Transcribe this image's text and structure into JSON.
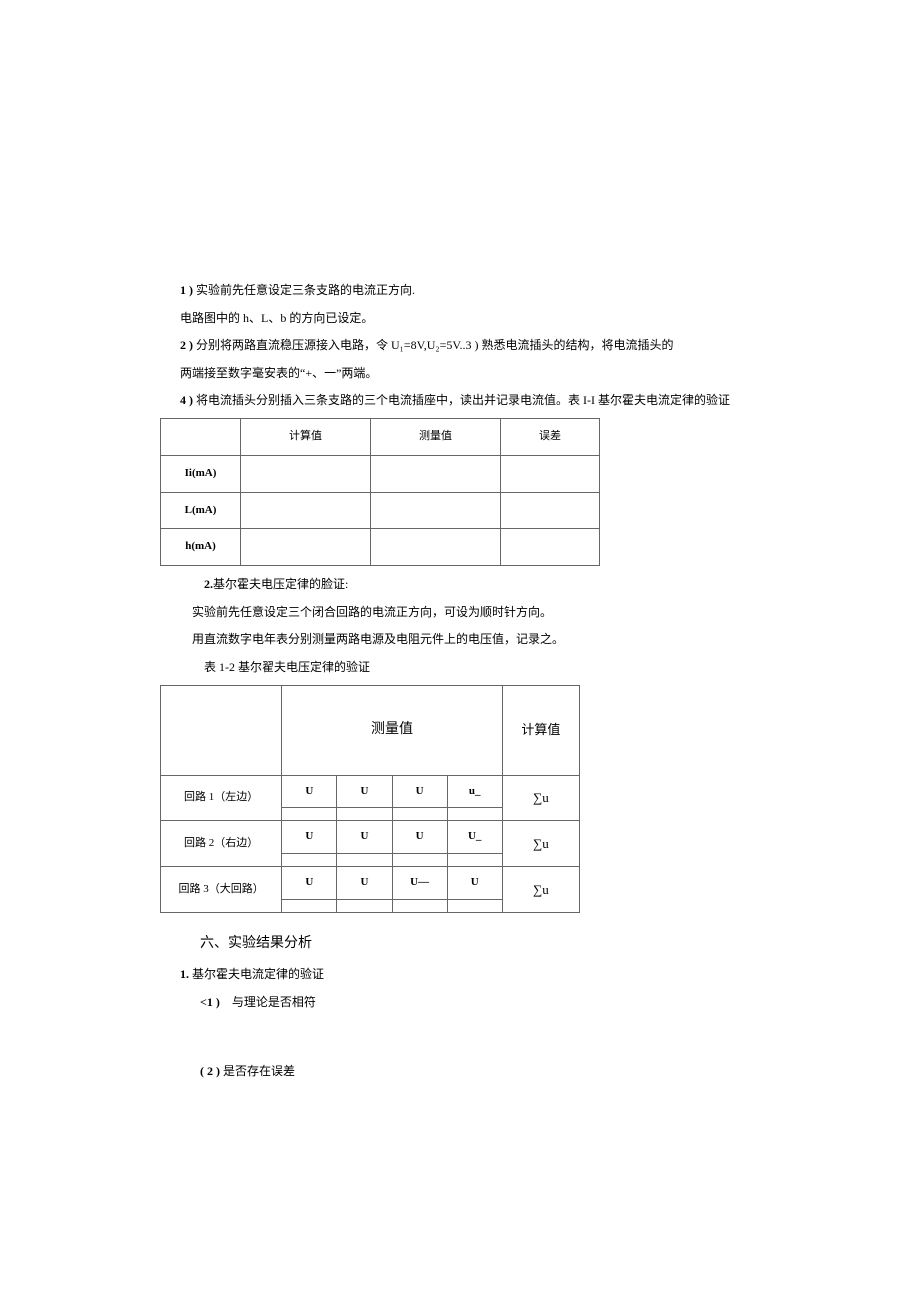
{
  "steps": {
    "s1_num": "1 )",
    "s1_text": "实验前先任意设定三条支路的电流正方向.",
    "s1b_text": "电路图中的 h、L、b 的方向已设定。",
    "s2_num": "2 )",
    "s2_text": "分别将两路直流稳压源接入电路，令 U₁=8V,U₂=5V..3 ) 熟悉电流插头的结构，将电流插头的",
    "s2b_text": "两端接至数字毫安表的“+、一”两端。",
    "s4_num": "4 )",
    "s4_text": "将电流插头分别插入三条支路的三个电流插座中，读出并记录电流值。表 I-I 基尔霍夫电流定律的验证"
  },
  "table1": {
    "hdr_calc": "计算值",
    "hdr_meas": "测量值",
    "hdr_err": "误差",
    "row1": "Ii(mA)",
    "row2": "L(mA)",
    "row3": "h(mA)"
  },
  "mid": {
    "p1_num": "2.",
    "p1_text": "基尔霍夫电压定律的脸证:",
    "p2_text": "实验前先任意设定三个闭合回路的电流正方向，可设为顺时针方向。",
    "p3_text": "用直流数字电年表分别测量两路电源及电阻元件上的电压值，记录之。",
    "caption2": "表 1-2 基尔翟夫电压定律的验证"
  },
  "table2": {
    "hdr_meas": "测量值",
    "hdr_calc": "计算值",
    "r1_lbl": "回路 1（左边）",
    "r2_lbl": "回路 2（右边）",
    "r3_lbl": "回路 3（大回路）",
    "u": "U",
    "u_under": "u_",
    "u_upper": "U_",
    "u_dash": "U—",
    "sigma": "∑u"
  },
  "section6": {
    "title": "六、实验结果分析",
    "p1_num": "1.",
    "p1_text": "基尔霍夫电流定律的验证",
    "q1_num": "<1 )",
    "q1_text": "与理论是否相符",
    "q2_num": "( 2 )",
    "q2_text": "是否存在误差"
  }
}
